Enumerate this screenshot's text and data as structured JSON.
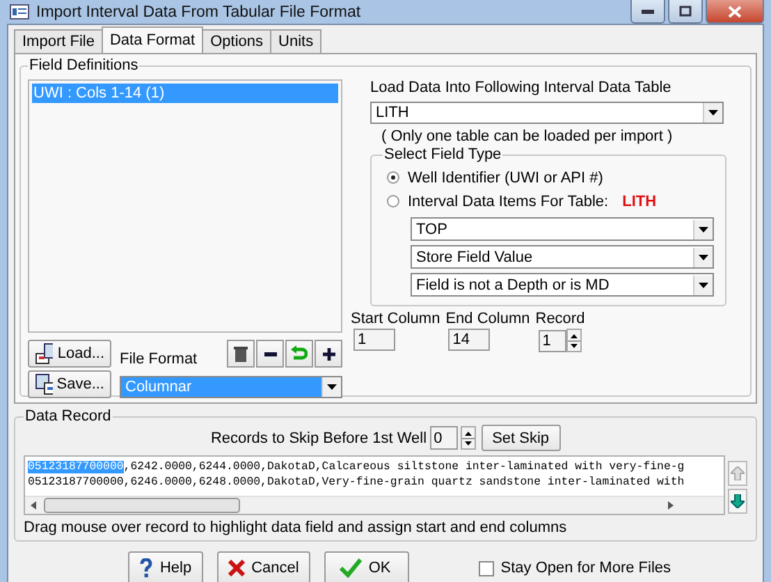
{
  "window": {
    "title": "Import Interval Data From Tabular File Format"
  },
  "tabs": [
    {
      "label": "Import File",
      "selected": false
    },
    {
      "label": "Data Format",
      "selected": true
    },
    {
      "label": "Options",
      "selected": false
    },
    {
      "label": "Units",
      "selected": false
    }
  ],
  "field_definitions": {
    "title": "Field Definitions",
    "items": [
      {
        "label": "UWI : Cols 1-14 (1)",
        "selected": true
      }
    ]
  },
  "load_button": "Load...",
  "save_button": "Save...",
  "file_format": {
    "label": "File Format",
    "value": "Columnar",
    "highlighted": true
  },
  "load_table": {
    "label": "Load Data Into Following Interval Data Table",
    "value": "LITH",
    "note": "( Only one table can be loaded per import )"
  },
  "field_type": {
    "title": "Select Field Type",
    "options": [
      {
        "label": "Well Identifier (UWI or API #)",
        "selected": true
      },
      {
        "label": "Interval Data Items For Table:",
        "table": "LITH",
        "selected": false
      }
    ],
    "dropdowns": [
      "TOP",
      "Store Field Value",
      "Field is not a Depth or is MD"
    ]
  },
  "columns": [
    {
      "label": "Start Column",
      "value": "1",
      "spinner": false
    },
    {
      "label": "End Column",
      "value": "14",
      "spinner": false
    },
    {
      "label": "Record",
      "value": "1",
      "spinner": true
    }
  ],
  "data_record": {
    "title": "Data Record",
    "skip_label": "Records to Skip Before 1st Well",
    "skip_value": "0",
    "set_skip": "Set Skip",
    "lines": [
      [
        {
          "text": "05123187700000",
          "selected": true
        },
        {
          "text": ",6242.0000,6244.0000,DakotaD,Calcareous siltstone inter-laminated with very-fine-g",
          "selected": false
        }
      ],
      [
        {
          "text": "05123187700000,6246.0000,6248.0000,DakotaD,Very-fine-grain quartz sandstone inter-laminated with",
          "selected": false
        }
      ]
    ],
    "hint": "Drag mouse over record to highlight data field and assign start and end columns"
  },
  "footer": {
    "help": "Help",
    "cancel": "Cancel",
    "ok": "OK",
    "stay_open": {
      "label": "Stay Open for More Files",
      "checked": false
    }
  }
}
